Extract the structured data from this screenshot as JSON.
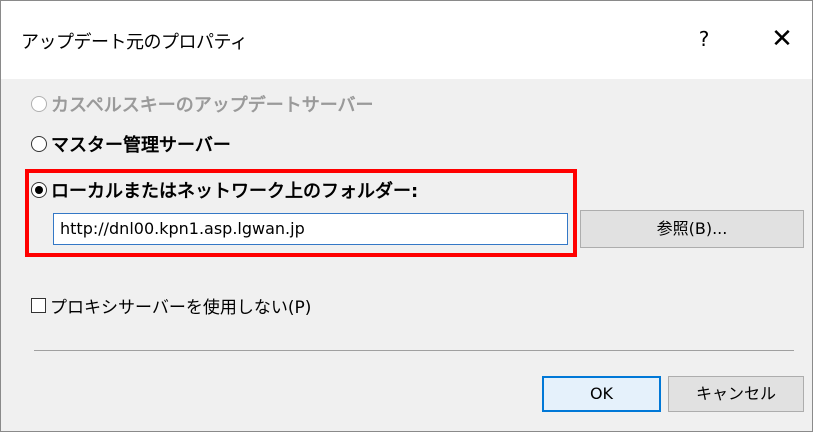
{
  "window": {
    "title": "アップデート元のプロパティ",
    "help_label": "?",
    "close_label": "✕"
  },
  "options": {
    "kaspersky_label": "カスペルスキーのアップデートサーバー",
    "kaspersky_enabled": false,
    "admin_server_label": "マスター管理サーバー",
    "local_folder_label": "ローカルまたはネットワーク上のフォルダー:",
    "selected": "local_folder"
  },
  "folder": {
    "path_value": "http://dnl00.kpn1.asp.lgwan.jp",
    "browse_label": "参照(B)..."
  },
  "proxy": {
    "label": "プロキシサーバーを使用しない(P)",
    "checked": false
  },
  "footer": {
    "ok_label": "OK",
    "cancel_label": "キャンセル"
  },
  "colors": {
    "highlight": "#ff0000",
    "focus_border": "#0078d7"
  }
}
